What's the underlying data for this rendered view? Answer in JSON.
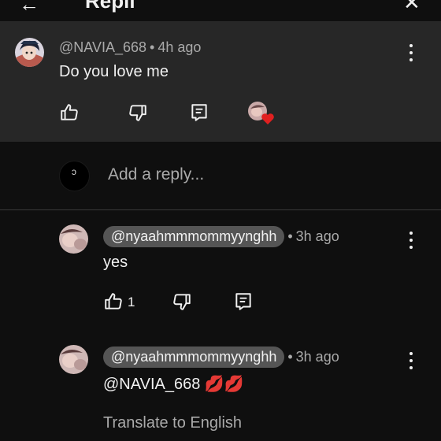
{
  "header": {
    "back_glyph": "←",
    "title": "Repli",
    "close_glyph": "✕"
  },
  "parent_comment": {
    "author": "@NAVIA_668",
    "time": "4h ago",
    "text": "Do you love me",
    "creator_heart": true
  },
  "reply_box": {
    "placeholder": "Add a reply..."
  },
  "replies": [
    {
      "author": "@nyaahmmmommyynghh",
      "time": "3h ago",
      "text": "yes",
      "likes": "1"
    },
    {
      "author": "@nyaahmmmommyynghh",
      "time": "3h ago",
      "text": "@NAVIA_668 💋💋",
      "translate_label": "Translate to English"
    }
  ],
  "colors": {
    "background": "#0f0f0f",
    "parent_background": "#272727",
    "chip": "#555555",
    "secondary_text": "#aaaaaa",
    "heart": "#e02020"
  }
}
